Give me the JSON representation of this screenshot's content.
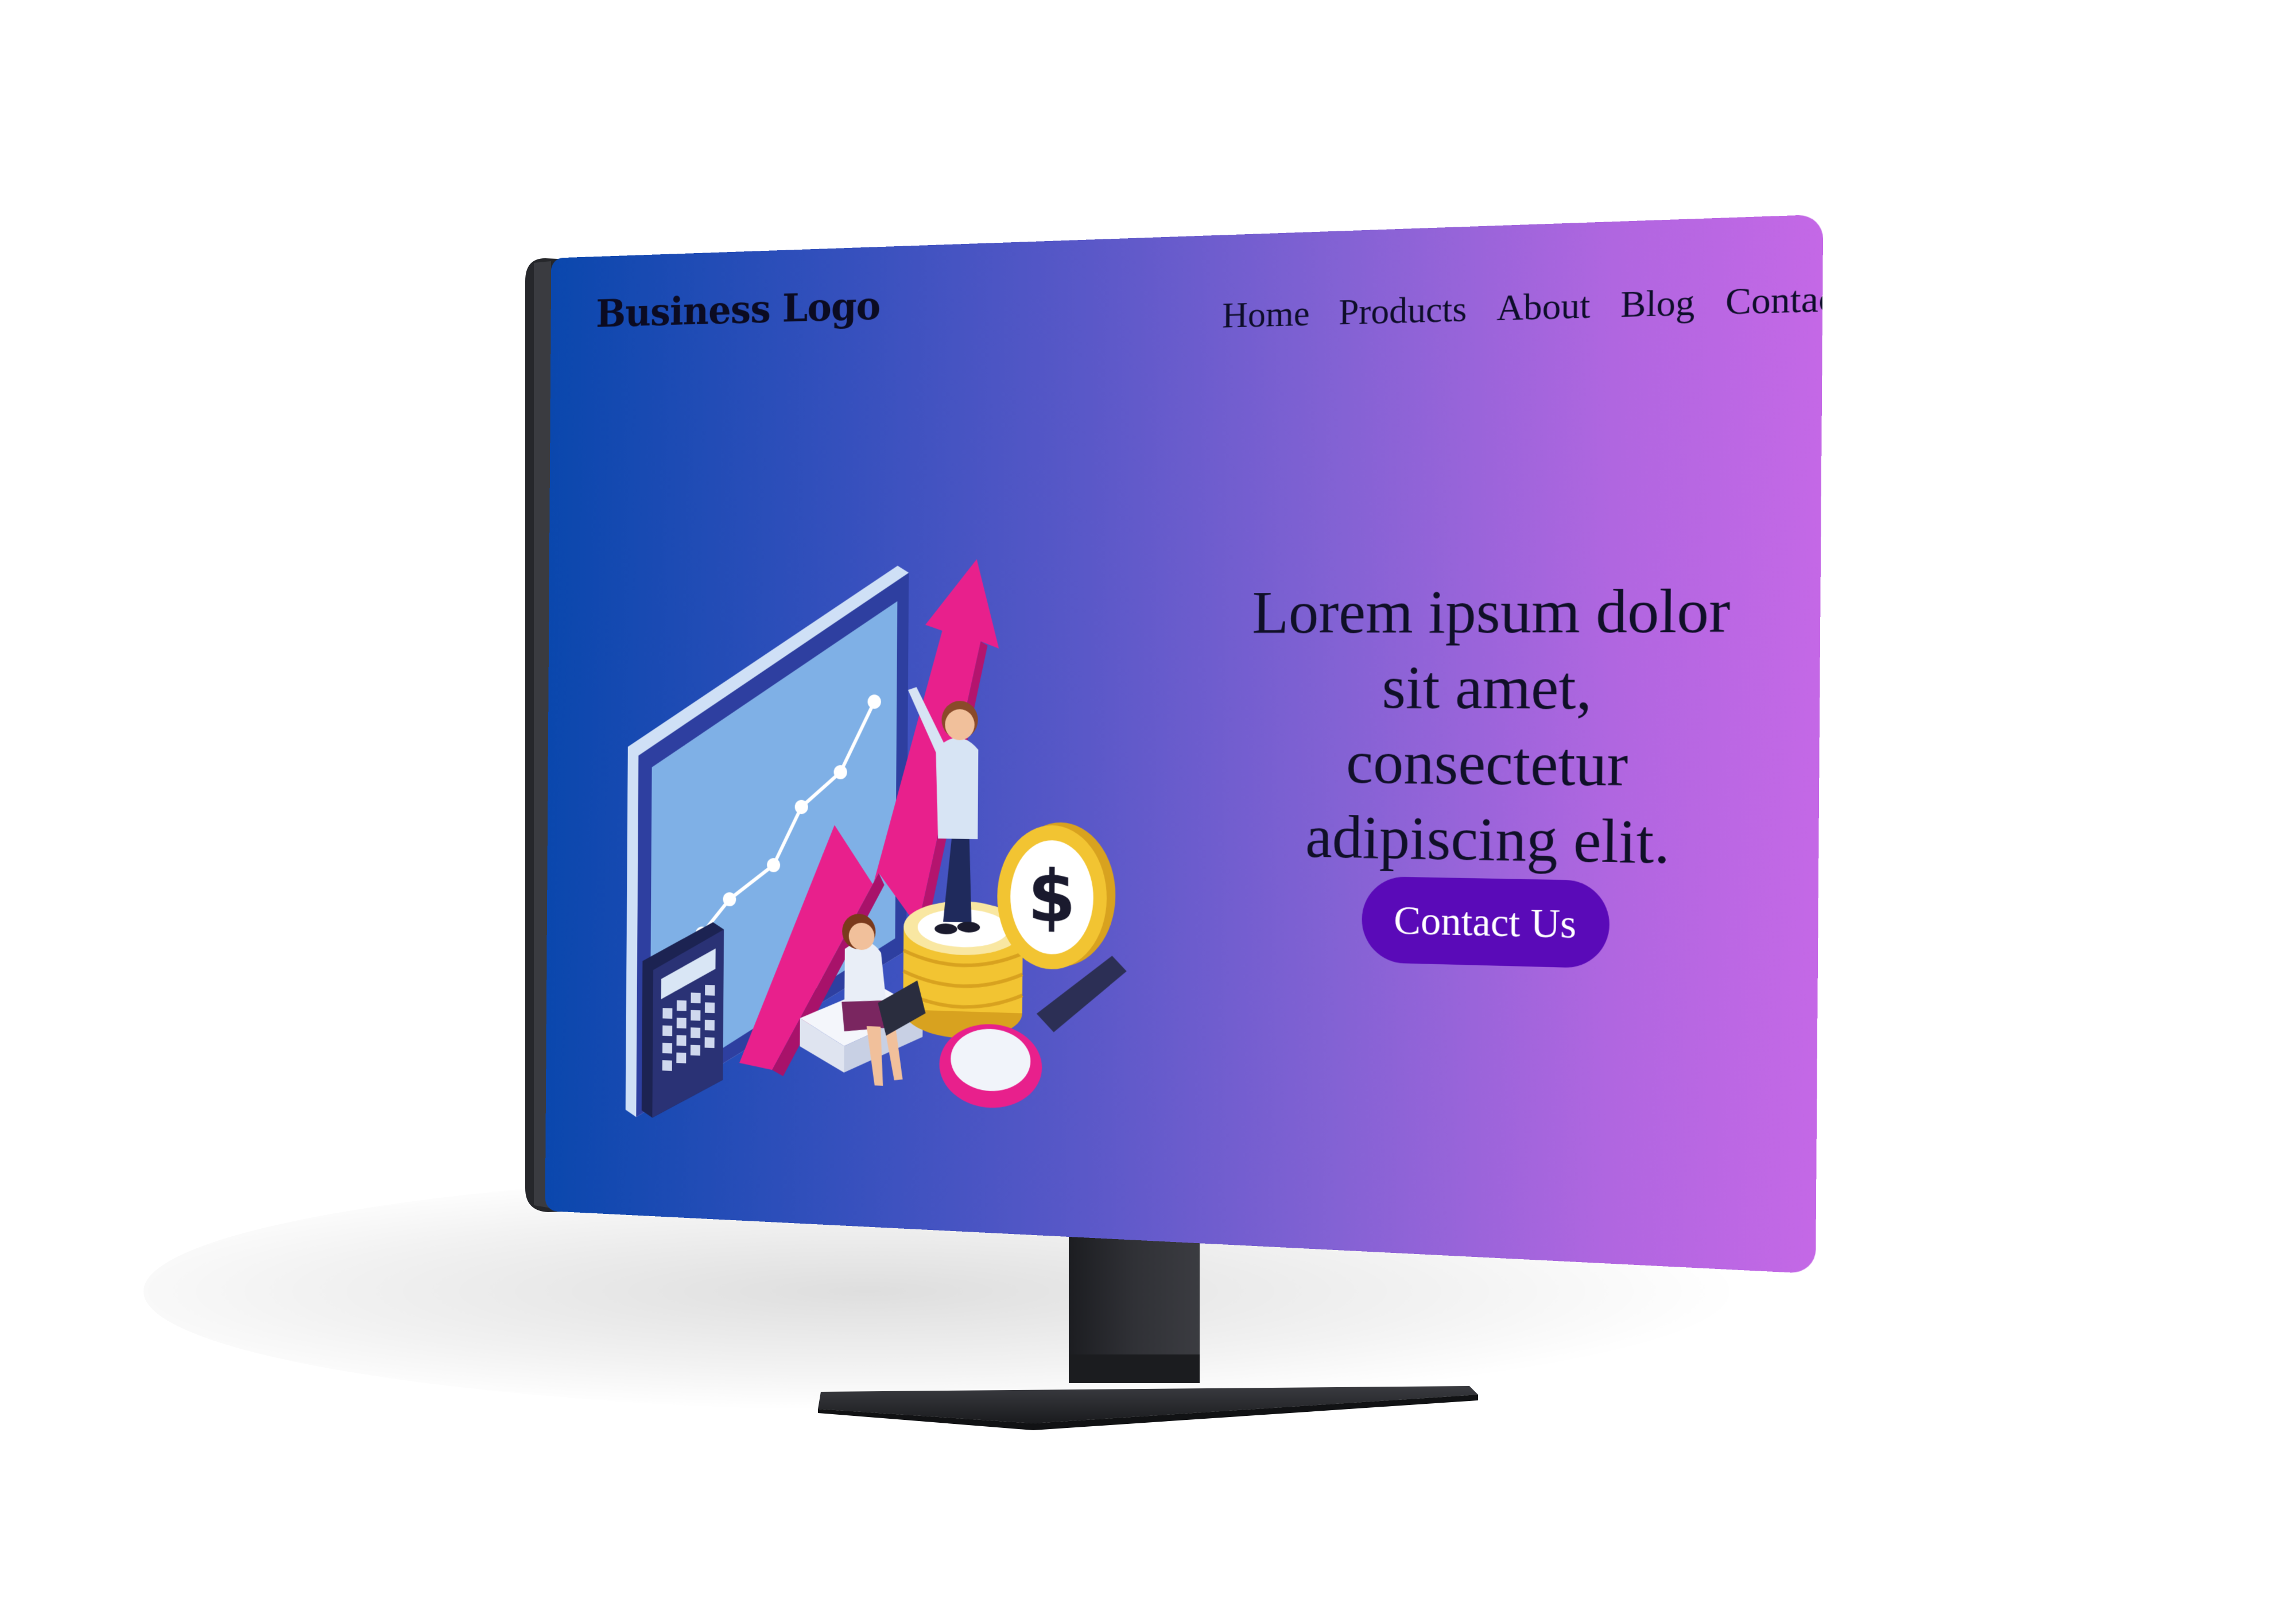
{
  "site": {
    "logo": "Business Logo",
    "nav": [
      {
        "label": "Home"
      },
      {
        "label": "Products"
      },
      {
        "label": "About"
      },
      {
        "label": "Blog"
      },
      {
        "label": "Contact"
      }
    ],
    "hero": {
      "heading": "Lorem ipsum dolor sit amet, consectetur adipiscing elit.",
      "cta_label": "Contact Us"
    }
  },
  "colors": {
    "gradient_start": "#0a47ad",
    "gradient_end": "#c468e6",
    "cta_bg": "#5a0ab8",
    "monitor_bezel": "#2b2c30",
    "accent_pink": "#e8208c",
    "coin_gold": "#f2c432"
  },
  "icons": [
    "growth-arrow-icon",
    "calculator-icon",
    "coin-dollar-icon",
    "magnifier-icon"
  ]
}
